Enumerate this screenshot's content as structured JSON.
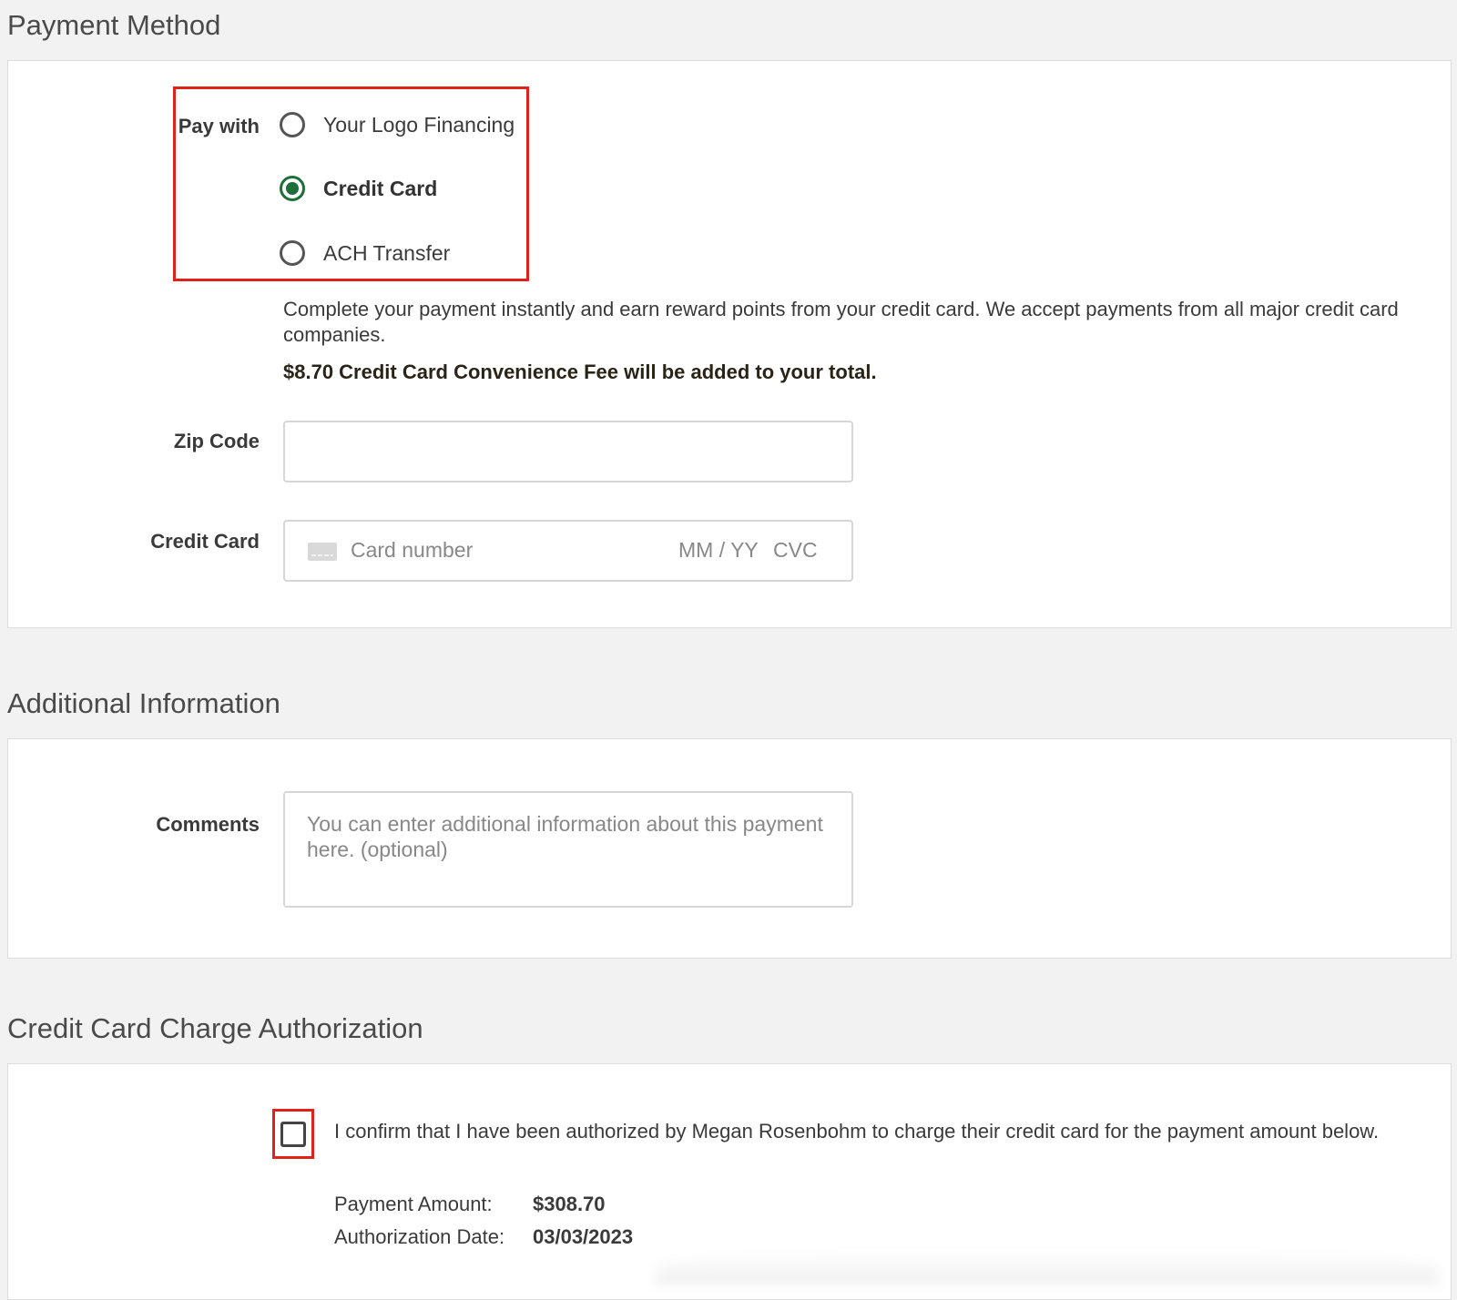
{
  "payment_method": {
    "title": "Payment Method",
    "pay_with_label": "Pay with",
    "options": [
      {
        "label": "Your Logo Financing",
        "selected": false
      },
      {
        "label": "Credit Card",
        "selected": true
      },
      {
        "label": "ACH Transfer",
        "selected": false
      }
    ],
    "description": "Complete your payment instantly and earn reward points from your credit card. We accept payments from all major credit card companies.",
    "fee_notice": "$8.70 Credit Card Convenience Fee will be added to your total.",
    "zip_label": "Zip Code",
    "zip_value": "",
    "credit_card_label": "Credit Card",
    "card_number_placeholder": "Card number",
    "expiry_placeholder": "MM / YY",
    "cvc_placeholder": "CVC",
    "card_icon": "credit-card-icon"
  },
  "additional_info": {
    "title": "Additional Information",
    "comments_label": "Comments",
    "comments_placeholder": "You can enter additional information about this payment here. (optional)"
  },
  "authorization": {
    "title": "Credit Card Charge Authorization",
    "checkbox_checked": false,
    "confirm_text": "I confirm that I have been authorized by Megan Rosenbohm to charge their credit card for the payment amount below.",
    "payment_amount_label": "Payment Amount:",
    "payment_amount_value": "$308.70",
    "authorization_date_label": "Authorization Date:",
    "authorization_date_value": "03/03/2023"
  },
  "colors": {
    "accent_green": "#1e6e3a",
    "highlight_red": "#e0231a",
    "page_bg": "#f2f2f2"
  }
}
